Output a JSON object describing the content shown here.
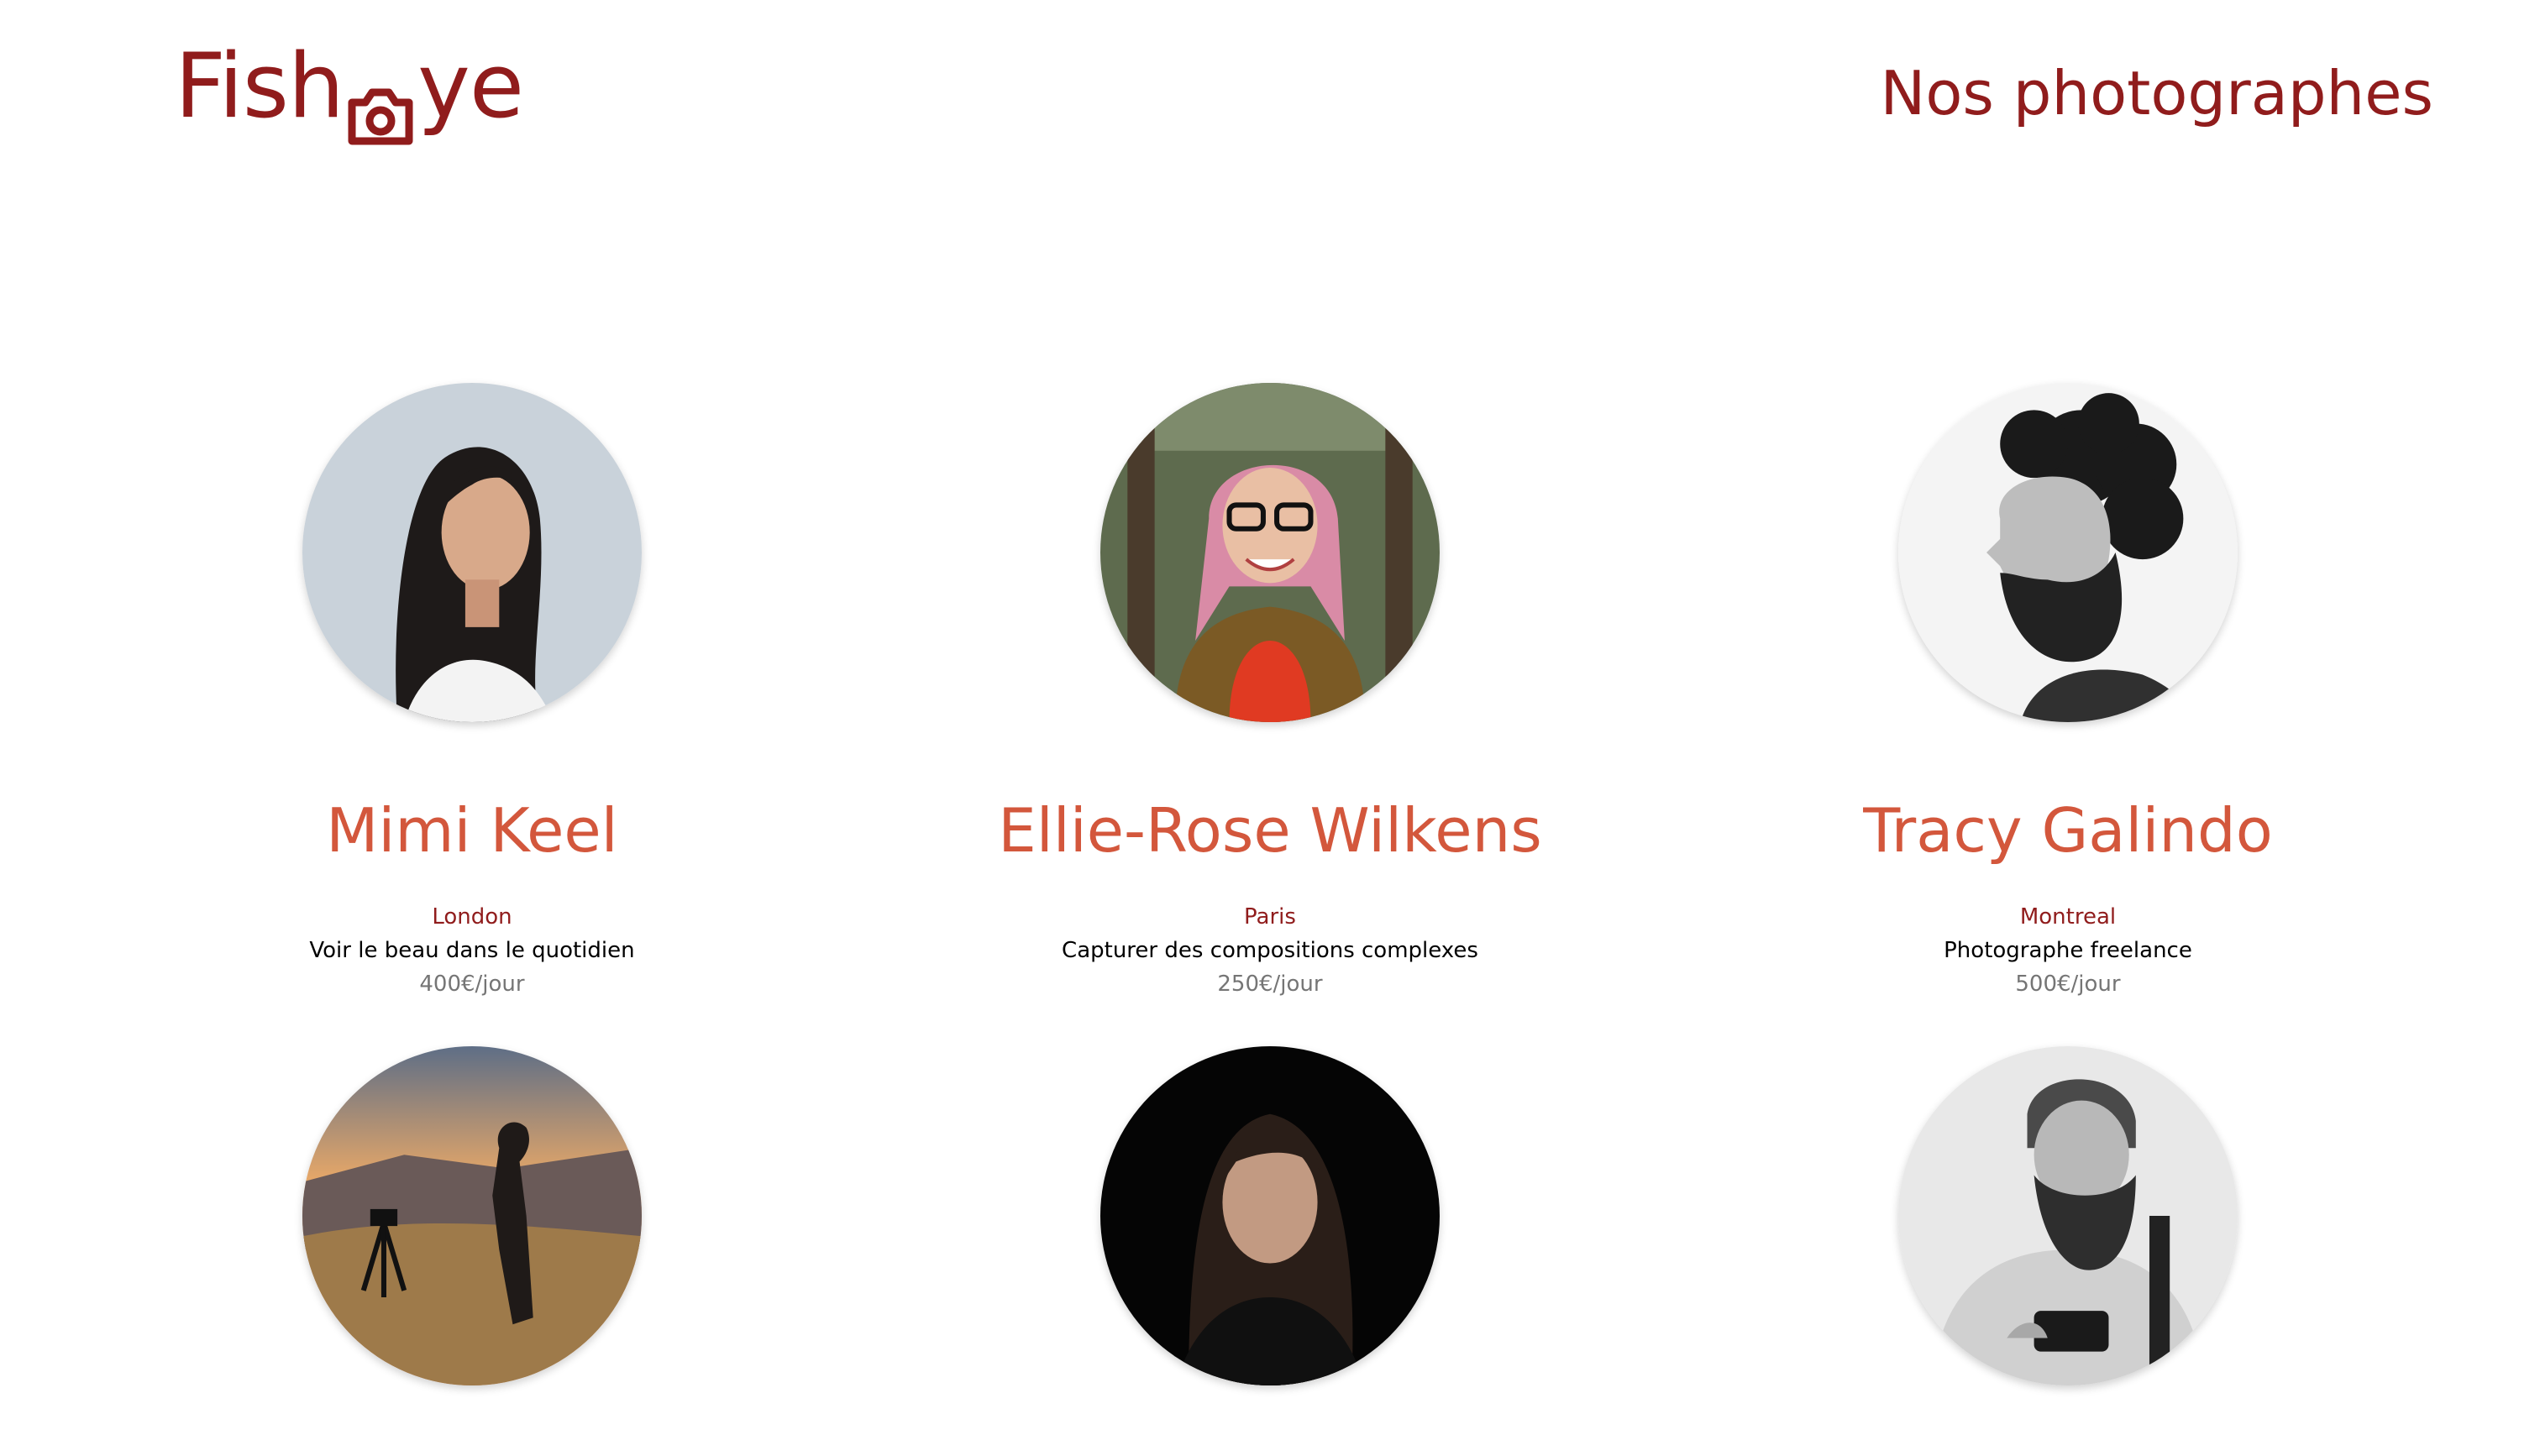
{
  "header": {
    "logo_before": "Fish",
    "logo_after": "ye",
    "logo_icon": "camera-icon",
    "title": "Nos photographes"
  },
  "colors": {
    "primary": "#901C1C",
    "name": "#D3573C",
    "text": "#000000",
    "muted": "#757575"
  },
  "photographers": [
    {
      "name": "Mimi Keel",
      "city": "London",
      "tagline": "Voir le beau dans le quotidien",
      "price": "400€/jour"
    },
    {
      "name": "Ellie-Rose Wilkens",
      "city": "Paris",
      "tagline": "Capturer des compositions complexes",
      "price": "250€/jour"
    },
    {
      "name": "Tracy Galindo",
      "city": "Montreal",
      "tagline": "Photographe freelance",
      "price": "500€/jour"
    },
    {
      "name": "",
      "city": "",
      "tagline": "",
      "price": ""
    },
    {
      "name": "",
      "city": "",
      "tagline": "",
      "price": ""
    },
    {
      "name": "",
      "city": "",
      "tagline": "",
      "price": ""
    }
  ]
}
